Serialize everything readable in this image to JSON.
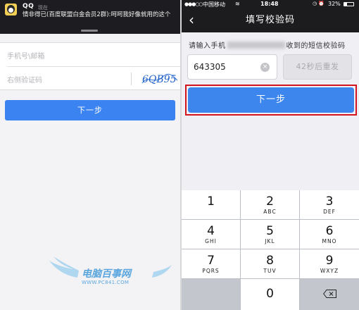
{
  "left": {
    "notification": {
      "app": "QQ",
      "time": "现在",
      "message": "情非得已(百度联盟白金会员2群):呵呵我好像就用的这个"
    },
    "form": {
      "phone_placeholder": "手机号\\邮箱",
      "captcha_placeholder": "右侧验证码",
      "captcha_text": "6QB95"
    },
    "next_button": "下一步"
  },
  "right": {
    "status_bar": {
      "signal": "●●●○○",
      "carrier": "中国移动",
      "wifi": "≋",
      "time": "18:48",
      "icons": "◷ ⏰",
      "battery": "32%"
    },
    "nav": {
      "back": "‹",
      "title": "填写校验码"
    },
    "instruction": {
      "prefix": "请输入手机",
      "suffix": "收到的短信校验码"
    },
    "code_input": {
      "value": "643305",
      "clear": "×"
    },
    "resend_button": "42秒后重发",
    "next_button": "下一步",
    "keypad": [
      {
        "num": "1",
        "letters": ""
      },
      {
        "num": "2",
        "letters": "ABC"
      },
      {
        "num": "3",
        "letters": "DEF"
      },
      {
        "num": "4",
        "letters": "GHI"
      },
      {
        "num": "5",
        "letters": "JKL"
      },
      {
        "num": "6",
        "letters": "MNO"
      },
      {
        "num": "7",
        "letters": "PQRS"
      },
      {
        "num": "8",
        "letters": "TUV"
      },
      {
        "num": "9",
        "letters": "WXYZ"
      },
      {
        "num": "0",
        "letters": ""
      }
    ]
  },
  "watermark": {
    "title": "电脑百事网",
    "url": "WWW.PC841.COM"
  },
  "colors": {
    "primary_button": "#3a83f1",
    "highlight_border": "#d3141e",
    "dark_bar": "#1c1c1e"
  }
}
